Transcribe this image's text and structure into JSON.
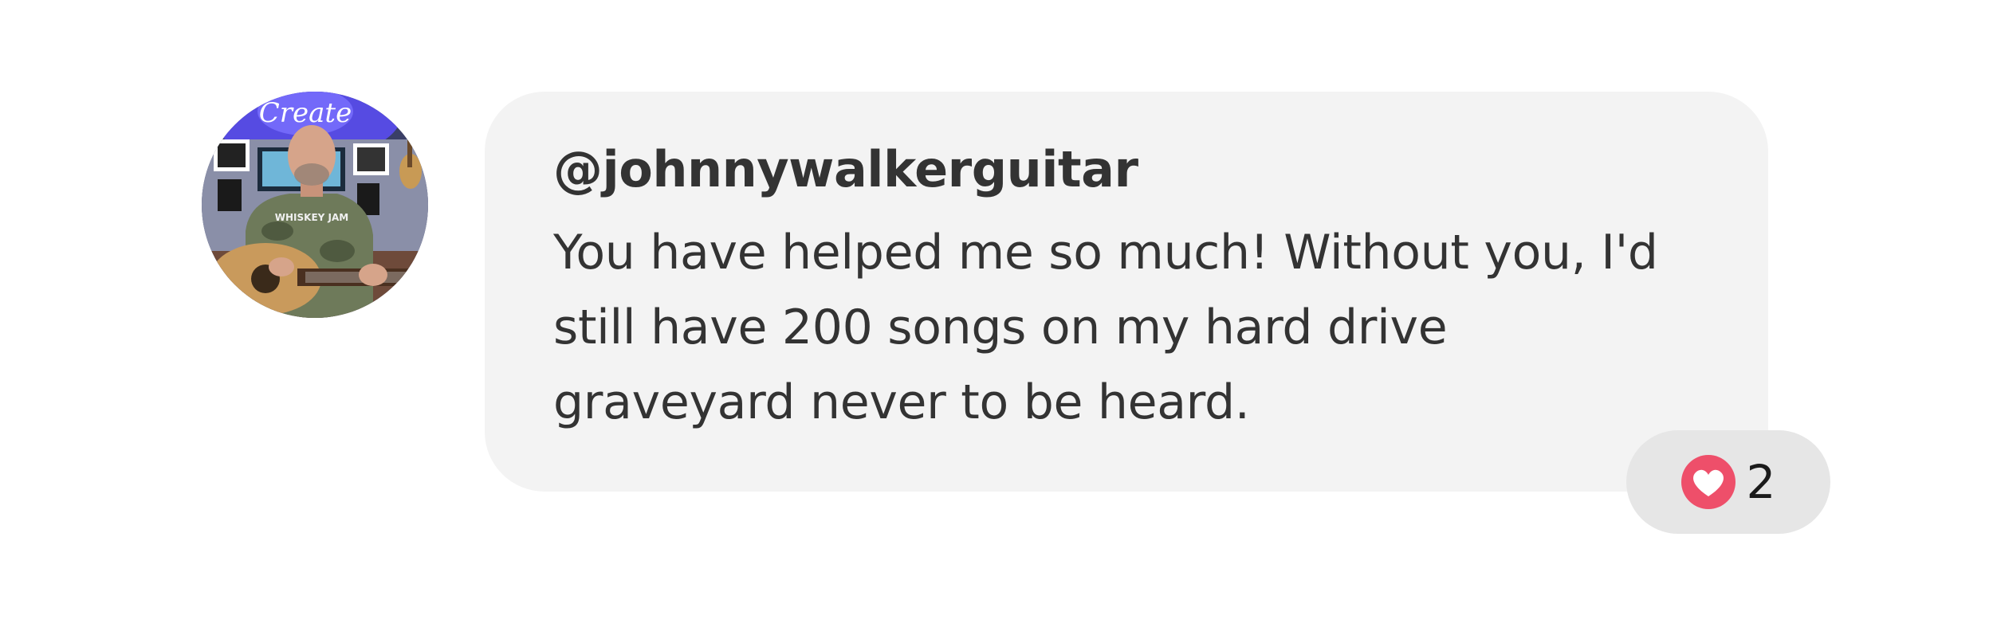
{
  "comment": {
    "handle": "@johnnywalkerguitar",
    "message": "You have helped me so much! Without you, I'd still have 200 songs on my hard drive graveyard never to be heard.",
    "avatar": {
      "icon": "profile-photo",
      "sign_text": "Create",
      "shirt_text": "WHISKEY JAM"
    }
  },
  "reaction": {
    "icon": "heart-icon",
    "count": "2",
    "color": "#ee4f6a"
  },
  "colors": {
    "bubble_background": "#f3f3f3",
    "reaction_background": "#e6e6e6",
    "text": "#333333"
  }
}
